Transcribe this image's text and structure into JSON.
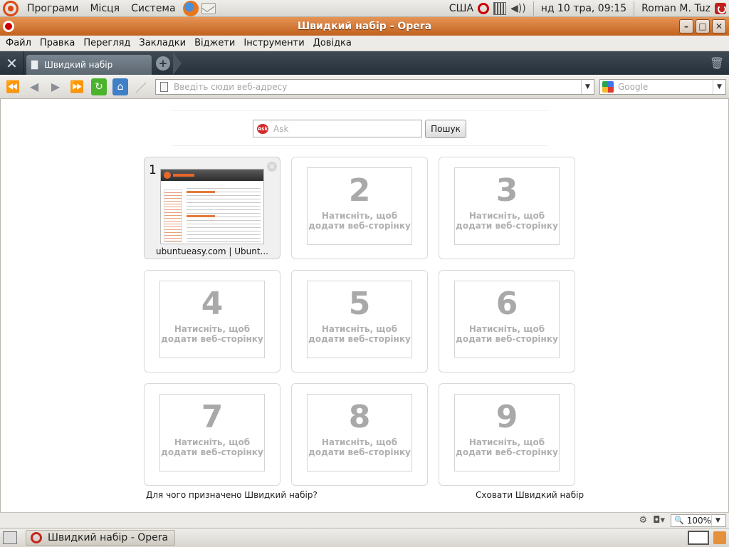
{
  "top_panel": {
    "menus": [
      "Програми",
      "Місця",
      "Система"
    ],
    "keyboard_layout": "США",
    "datetime": "нд 10 тра, 09:15",
    "user": "Roman M. Tuz"
  },
  "window": {
    "title": "Швидкий набір - Opera"
  },
  "menubar": {
    "items": [
      "Файл",
      "Правка",
      "Перегляд",
      "Закладки",
      "Віджети",
      "Інструменти",
      "Довідка"
    ]
  },
  "tabs": [
    {
      "label": "Швидкий набір"
    }
  ],
  "address_bar": {
    "placeholder": "Введіть сюди веб-адресу",
    "value": ""
  },
  "search_bar": {
    "placeholder": "Google",
    "engine_icon": "google-icon"
  },
  "ask_search": {
    "placeholder": "Ask",
    "button_label": "Пошук"
  },
  "speed_dial": [
    {
      "number": "1",
      "title": "ubuntueasy.com | Ubunt...",
      "filled": true
    },
    {
      "number": "2",
      "hint": "Натисніть, щоб додати веб-сторінку"
    },
    {
      "number": "3",
      "hint": "Натисніть, щоб додати веб-сторінку"
    },
    {
      "number": "4",
      "hint": "Натисніть, щоб додати веб-сторінку"
    },
    {
      "number": "5",
      "hint": "Натисніть, щоб додати веб-сторінку"
    },
    {
      "number": "6",
      "hint": "Натисніть, щоб додати веб-сторінку"
    },
    {
      "number": "7",
      "hint": "Натисніть, щоб додати веб-сторінку"
    },
    {
      "number": "8",
      "hint": "Натисніть, щоб додати веб-сторінку"
    },
    {
      "number": "9",
      "hint": "Натисніть, щоб додати веб-сторінку"
    }
  ],
  "footer": {
    "help_link": "Для чого призначено Швидкий набір?",
    "hide_link": "Сховати Швидкий набір"
  },
  "statusbar": {
    "zoom": "100%"
  },
  "taskbar": {
    "task_label": "Швидкий набір - Opera"
  },
  "colors": {
    "titlebar": "#d57631",
    "tabbar": "#2e3843",
    "reload_button": "#4bb32e",
    "home_button": "#3f7fc6"
  }
}
